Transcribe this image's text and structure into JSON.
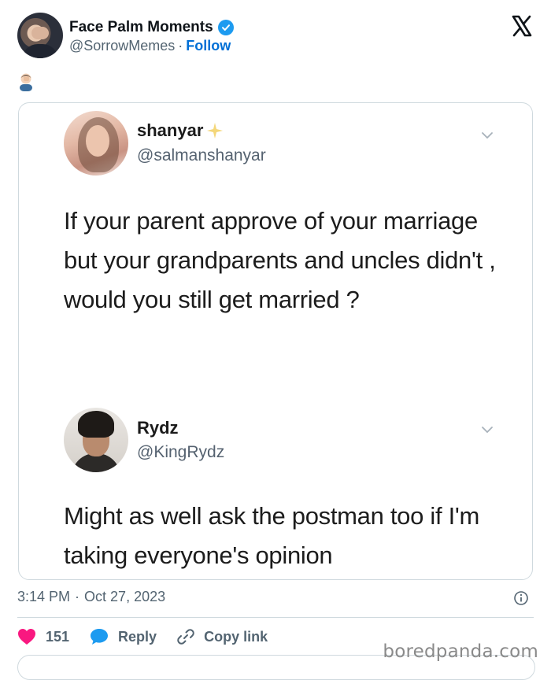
{
  "author": {
    "name": "Face Palm Moments",
    "handle": "@SorrowMemes",
    "separator": "·",
    "follow_label": "Follow"
  },
  "post": {
    "emoji": "🤦🏻‍♂️",
    "time": "3:14 PM",
    "separator": "·",
    "date": "Oct 27, 2023"
  },
  "embedded": {
    "tweet1": {
      "name": "shanyar",
      "handle": "@salmanshanyar",
      "text": "If your parent approve of your marriage but your grandparents and uncles didn't , would you still get married ?"
    },
    "tweet2": {
      "name": "Rydz",
      "handle": "@KingRydz",
      "text": "Might as well ask the postman too if I'm taking everyone's opinion"
    }
  },
  "actions": {
    "like_count": "151",
    "reply_label": "Reply",
    "copy_label": "Copy link"
  },
  "watermark": "boredpanda.com",
  "colors": {
    "accent": "#1d9bf0",
    "follow": "#006fd6",
    "like": "#f91880",
    "muted": "#536471"
  },
  "icons": [
    "verified-badge-icon",
    "x-logo-icon",
    "sparkle-icon",
    "chevron-down-icon",
    "info-icon",
    "heart-icon",
    "reply-bubble-icon",
    "link-icon"
  ]
}
